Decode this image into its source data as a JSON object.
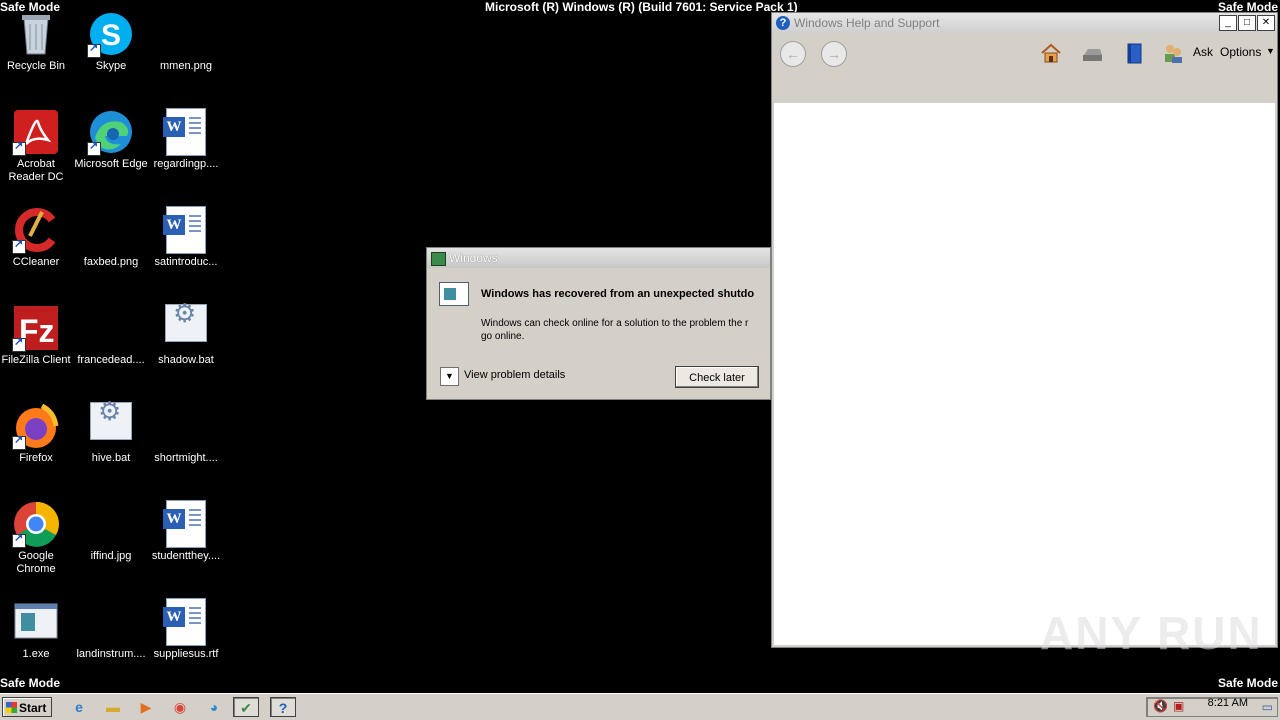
{
  "safe_mode_label": "Safe Mode",
  "build_text": "Microsoft (R) Windows (R) (Build 7601: Service Pack 1)",
  "desktop_icons": [
    {
      "label": "Recycle Bin",
      "icon": "recycle-bin-icon"
    },
    {
      "label": "Skype",
      "icon": "skype-icon"
    },
    {
      "label": "mmen.png",
      "icon": "image-file-icon"
    },
    {
      "label": "Acrobat Reader DC",
      "icon": "acrobat-icon"
    },
    {
      "label": "Microsoft Edge",
      "icon": "edge-icon"
    },
    {
      "label": "regardingp....",
      "icon": "word-doc-icon"
    },
    {
      "label": "CCleaner",
      "icon": "ccleaner-icon"
    },
    {
      "label": "faxbed.png",
      "icon": "image-file-icon"
    },
    {
      "label": "satintroduc...",
      "icon": "word-doc-icon"
    },
    {
      "label": "FileZilla Client",
      "icon": "filezilla-icon"
    },
    {
      "label": "francedead....",
      "icon": "file-icon"
    },
    {
      "label": "shadow.bat",
      "icon": "batch-file-icon"
    },
    {
      "label": "Firefox",
      "icon": "firefox-icon"
    },
    {
      "label": "hive.bat",
      "icon": "batch-file-icon"
    },
    {
      "label": "shortmight....",
      "icon": "file-icon"
    },
    {
      "label": "Google Chrome",
      "icon": "chrome-icon"
    },
    {
      "label": "iffind.jpg",
      "icon": "image-file-icon"
    },
    {
      "label": "studentthey....",
      "icon": "word-doc-icon"
    },
    {
      "label": "1.exe",
      "icon": "exe-icon"
    },
    {
      "label": "landinstrum....",
      "icon": "file-icon"
    },
    {
      "label": "suppliesus.rtf",
      "icon": "word-doc-icon"
    }
  ],
  "help_window": {
    "title": "Windows Help and Support",
    "ask_label": "Ask",
    "options_label": "Options"
  },
  "dialog": {
    "title": "Windows",
    "heading": "Windows has recovered from an unexpected shutdo",
    "body_line1": "Windows can check online for a solution to the problem the r",
    "body_line2": "go online.",
    "details_label": "View problem details",
    "check_later_label": "Check later"
  },
  "taskbar": {
    "start_label": "Start",
    "clock": "8:21 AM"
  },
  "watermark": "ANY RUN"
}
